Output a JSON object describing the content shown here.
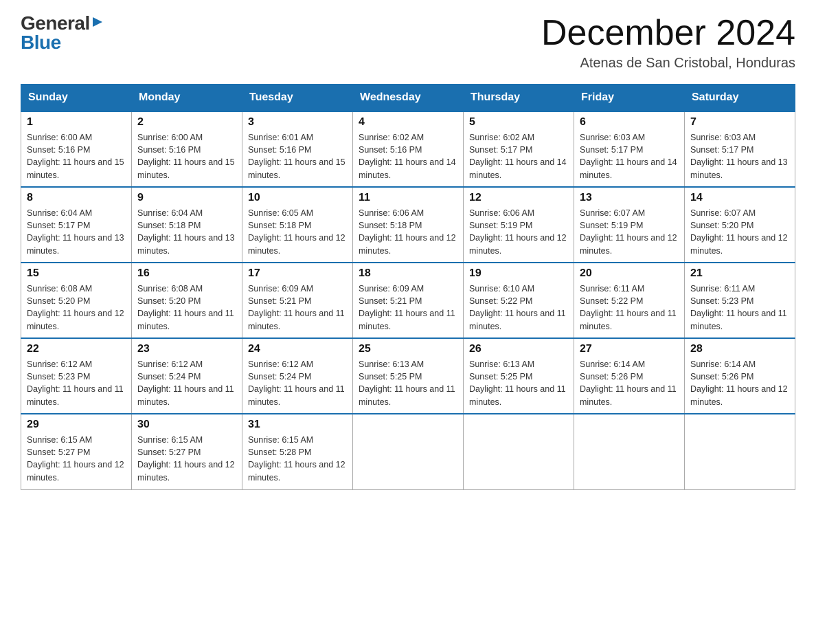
{
  "logo": {
    "general": "General",
    "blue": "Blue",
    "triangle": "▶"
  },
  "title": "December 2024",
  "location": "Atenas de San Cristobal, Honduras",
  "days_of_week": [
    "Sunday",
    "Monday",
    "Tuesday",
    "Wednesday",
    "Thursday",
    "Friday",
    "Saturday"
  ],
  "weeks": [
    [
      {
        "day": "1",
        "sunrise": "6:00 AM",
        "sunset": "5:16 PM",
        "daylight": "11 hours and 15 minutes."
      },
      {
        "day": "2",
        "sunrise": "6:00 AM",
        "sunset": "5:16 PM",
        "daylight": "11 hours and 15 minutes."
      },
      {
        "day": "3",
        "sunrise": "6:01 AM",
        "sunset": "5:16 PM",
        "daylight": "11 hours and 15 minutes."
      },
      {
        "day": "4",
        "sunrise": "6:02 AM",
        "sunset": "5:16 PM",
        "daylight": "11 hours and 14 minutes."
      },
      {
        "day": "5",
        "sunrise": "6:02 AM",
        "sunset": "5:17 PM",
        "daylight": "11 hours and 14 minutes."
      },
      {
        "day": "6",
        "sunrise": "6:03 AM",
        "sunset": "5:17 PM",
        "daylight": "11 hours and 14 minutes."
      },
      {
        "day": "7",
        "sunrise": "6:03 AM",
        "sunset": "5:17 PM",
        "daylight": "11 hours and 13 minutes."
      }
    ],
    [
      {
        "day": "8",
        "sunrise": "6:04 AM",
        "sunset": "5:17 PM",
        "daylight": "11 hours and 13 minutes."
      },
      {
        "day": "9",
        "sunrise": "6:04 AM",
        "sunset": "5:18 PM",
        "daylight": "11 hours and 13 minutes."
      },
      {
        "day": "10",
        "sunrise": "6:05 AM",
        "sunset": "5:18 PM",
        "daylight": "11 hours and 12 minutes."
      },
      {
        "day": "11",
        "sunrise": "6:06 AM",
        "sunset": "5:18 PM",
        "daylight": "11 hours and 12 minutes."
      },
      {
        "day": "12",
        "sunrise": "6:06 AM",
        "sunset": "5:19 PM",
        "daylight": "11 hours and 12 minutes."
      },
      {
        "day": "13",
        "sunrise": "6:07 AM",
        "sunset": "5:19 PM",
        "daylight": "11 hours and 12 minutes."
      },
      {
        "day": "14",
        "sunrise": "6:07 AM",
        "sunset": "5:20 PM",
        "daylight": "11 hours and 12 minutes."
      }
    ],
    [
      {
        "day": "15",
        "sunrise": "6:08 AM",
        "sunset": "5:20 PM",
        "daylight": "11 hours and 12 minutes."
      },
      {
        "day": "16",
        "sunrise": "6:08 AM",
        "sunset": "5:20 PM",
        "daylight": "11 hours and 11 minutes."
      },
      {
        "day": "17",
        "sunrise": "6:09 AM",
        "sunset": "5:21 PM",
        "daylight": "11 hours and 11 minutes."
      },
      {
        "day": "18",
        "sunrise": "6:09 AM",
        "sunset": "5:21 PM",
        "daylight": "11 hours and 11 minutes."
      },
      {
        "day": "19",
        "sunrise": "6:10 AM",
        "sunset": "5:22 PM",
        "daylight": "11 hours and 11 minutes."
      },
      {
        "day": "20",
        "sunrise": "6:11 AM",
        "sunset": "5:22 PM",
        "daylight": "11 hours and 11 minutes."
      },
      {
        "day": "21",
        "sunrise": "6:11 AM",
        "sunset": "5:23 PM",
        "daylight": "11 hours and 11 minutes."
      }
    ],
    [
      {
        "day": "22",
        "sunrise": "6:12 AM",
        "sunset": "5:23 PM",
        "daylight": "11 hours and 11 minutes."
      },
      {
        "day": "23",
        "sunrise": "6:12 AM",
        "sunset": "5:24 PM",
        "daylight": "11 hours and 11 minutes."
      },
      {
        "day": "24",
        "sunrise": "6:12 AM",
        "sunset": "5:24 PM",
        "daylight": "11 hours and 11 minutes."
      },
      {
        "day": "25",
        "sunrise": "6:13 AM",
        "sunset": "5:25 PM",
        "daylight": "11 hours and 11 minutes."
      },
      {
        "day": "26",
        "sunrise": "6:13 AM",
        "sunset": "5:25 PM",
        "daylight": "11 hours and 11 minutes."
      },
      {
        "day": "27",
        "sunrise": "6:14 AM",
        "sunset": "5:26 PM",
        "daylight": "11 hours and 11 minutes."
      },
      {
        "day": "28",
        "sunrise": "6:14 AM",
        "sunset": "5:26 PM",
        "daylight": "11 hours and 12 minutes."
      }
    ],
    [
      {
        "day": "29",
        "sunrise": "6:15 AM",
        "sunset": "5:27 PM",
        "daylight": "11 hours and 12 minutes."
      },
      {
        "day": "30",
        "sunrise": "6:15 AM",
        "sunset": "5:27 PM",
        "daylight": "11 hours and 12 minutes."
      },
      {
        "day": "31",
        "sunrise": "6:15 AM",
        "sunset": "5:28 PM",
        "daylight": "11 hours and 12 minutes."
      },
      null,
      null,
      null,
      null
    ]
  ]
}
